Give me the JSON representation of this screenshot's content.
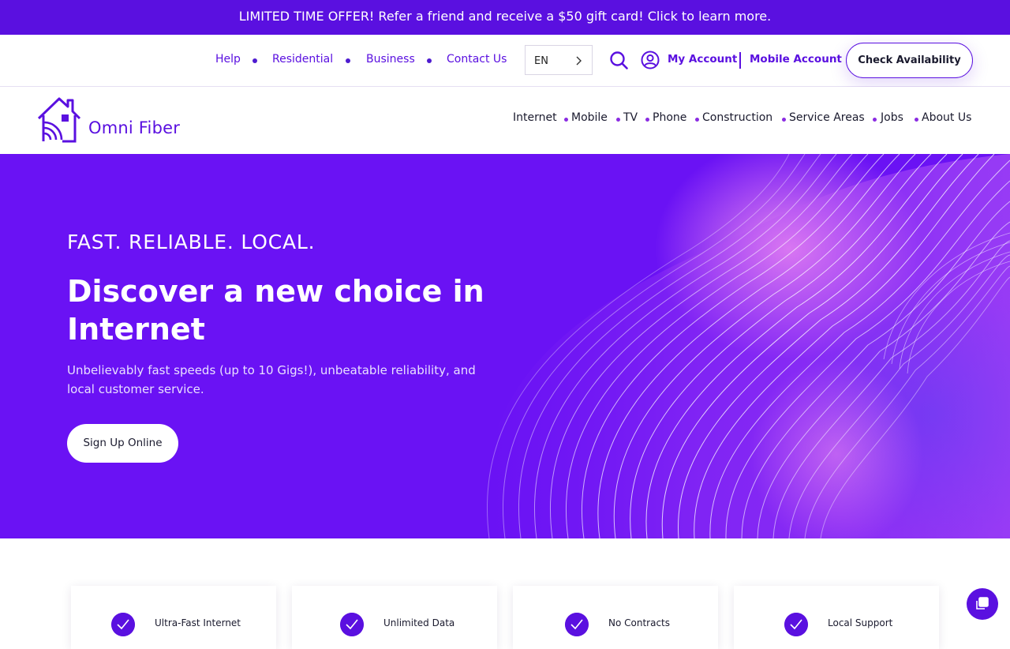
{
  "promo": {
    "text": "LIMITED TIME OFFER! Refer a friend and receive a $50 gift card! Click to learn more."
  },
  "utility_nav": {
    "links": [
      "Help",
      "Residential",
      "Business",
      "Contact Us"
    ],
    "language": "EN",
    "my_account": "My Account",
    "mobile_account": "Mobile Account",
    "check_availability": "Check Availability"
  },
  "brand": {
    "name": "Omni Fiber"
  },
  "main_nav": {
    "items": [
      "Internet",
      "Mobile",
      "TV",
      "Phone",
      "Construction",
      "Service Areas",
      "Jobs",
      "About Us"
    ]
  },
  "hero": {
    "eyebrow": "FAST. RELIABLE. LOCAL.",
    "headline": "Discover a new choice in Internet",
    "subtext": "Unbelievably fast speeds (up to 10 Gigs!), unbeatable reliability, and local customer service.",
    "cta": "Sign Up Online"
  },
  "features": [
    "Ultra-Fast Internet",
    "Unlimited Data",
    "No Contracts",
    "Local Support"
  ],
  "colors": {
    "brand_purple": "#5a10e0",
    "hero_purple": "#6a12f4",
    "text_dark": "#1a1a2e"
  },
  "icons": [
    "search-icon",
    "user-circle-icon",
    "chevron-right-icon",
    "house-wifi-icon",
    "check-icon",
    "chat-icon"
  ]
}
